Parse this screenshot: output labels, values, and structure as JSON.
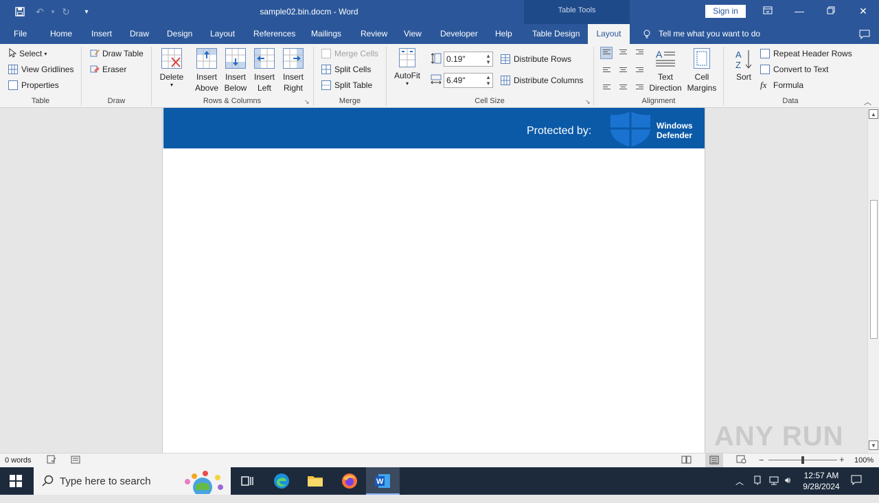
{
  "window": {
    "doc_title": "sample02.bin.docm  -  Word",
    "context_label": "Table Tools",
    "sign_in": "Sign in"
  },
  "tabs": [
    {
      "label": "File"
    },
    {
      "label": "Home"
    },
    {
      "label": "Insert"
    },
    {
      "label": "Draw"
    },
    {
      "label": "Design"
    },
    {
      "label": "Layout"
    },
    {
      "label": "References"
    },
    {
      "label": "Mailings"
    },
    {
      "label": "Review"
    },
    {
      "label": "View"
    },
    {
      "label": "Developer"
    },
    {
      "label": "Help"
    },
    {
      "label": "Table Design"
    },
    {
      "label": "Layout"
    }
  ],
  "tell_me": "Tell me what you want to do",
  "ribbon": {
    "table": {
      "select": "Select",
      "view_gridlines": "View Gridlines",
      "properties": "Properties",
      "label": "Table"
    },
    "draw": {
      "draw_table": "Draw Table",
      "eraser": "Eraser",
      "label": "Draw"
    },
    "rows_cols": {
      "delete": "Delete",
      "insert_above": [
        "Insert",
        "Above"
      ],
      "insert_below": [
        "Insert",
        "Below"
      ],
      "insert_left": [
        "Insert",
        "Left"
      ],
      "insert_right": [
        "Insert",
        "Right"
      ],
      "label": "Rows & Columns"
    },
    "merge": {
      "merge_cells": "Merge Cells",
      "split_cells": "Split Cells",
      "split_table": "Split Table",
      "label": "Merge"
    },
    "cell_size": {
      "autofit": "AutoFit",
      "height": "0.19\"",
      "width": "6.49\"",
      "distribute_rows": "Distribute Rows",
      "distribute_columns": "Distribute Columns",
      "label": "Cell Size"
    },
    "alignment": {
      "text_direction": [
        "Text",
        "Direction"
      ],
      "cell_margins": [
        "Cell",
        "Margins"
      ],
      "label": "Alignment"
    },
    "data": {
      "sort": "Sort",
      "repeat_header": "Repeat Header Rows",
      "convert_text": "Convert to Text",
      "formula": "Formula",
      "label": "Data"
    }
  },
  "document": {
    "protected_by": "Protected by:",
    "defender": [
      "Windows",
      "Defender"
    ]
  },
  "status": {
    "words": "0 words",
    "zoom": "100%"
  },
  "taskbar": {
    "search_placeholder": "Type here to search",
    "time": "12:57 AM",
    "date": "9/28/2024"
  },
  "watermark": "ANY RUN",
  "colors": {
    "word_blue": "#2b579a",
    "banner_blue": "#0b5aa8",
    "taskbar": "#1c2a3c"
  }
}
